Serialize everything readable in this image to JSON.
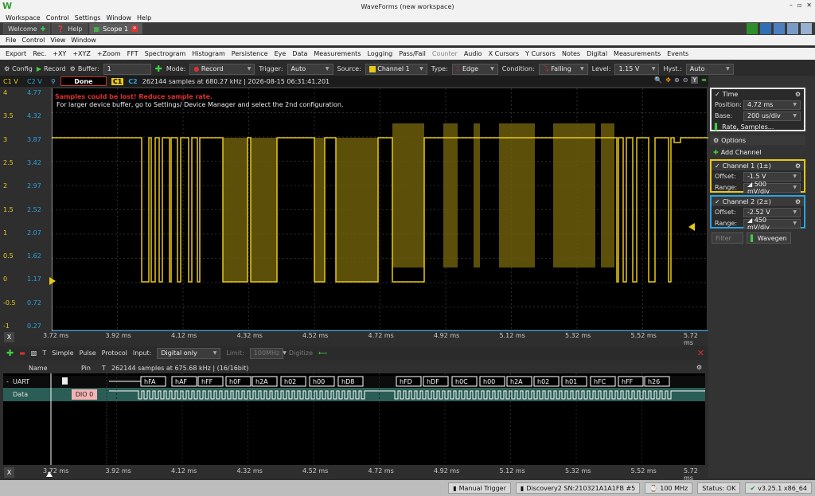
{
  "app": {
    "title": "WaveForms (new workspace)",
    "window_controls": [
      "–",
      "▫",
      "✕"
    ]
  },
  "main_menu": [
    "Workspace",
    "Control",
    "Settings",
    "Window",
    "Help"
  ],
  "tabs": [
    {
      "label": "Welcome"
    },
    {
      "label": "Help"
    },
    {
      "label": "Scope 1"
    }
  ],
  "scope_menu": [
    "File",
    "Control",
    "View",
    "Window"
  ],
  "scope_toolbar": [
    "Export",
    "Rec.",
    "+XY",
    "+XYZ",
    "+Zoom",
    "FFT",
    "Spectrogram",
    "Histogram",
    "Persistence",
    "Eye",
    "Data",
    "Measurements",
    "Logging",
    "Pass/Fail",
    "Counter",
    "Audio",
    "X Cursors",
    "Y Cursors",
    "Notes",
    "Digital",
    "Measurements",
    "Events"
  ],
  "acquisition": {
    "config_label": "Config",
    "record_label": "Record",
    "buffer_label": "Buffer:",
    "buffer_value": "1",
    "mode_label": "Mode:",
    "mode_value": "Record",
    "trigger_label": "Trigger:",
    "trigger_value": "Auto",
    "source_label": "Source:",
    "source_value": "Channel 1",
    "type_label": "Type:",
    "type_value": "Edge",
    "condition_label": "Condition:",
    "condition_value": "Falling",
    "level_label": "Level:",
    "level_value": "1.15 V",
    "hyst_label": "Hyst.:",
    "hyst_value": "Auto"
  },
  "plot_status": {
    "c1": "C1 V",
    "c2": "C2 V",
    "state": "Done",
    "c1_tag": "C1",
    "c2_tag": "C2",
    "info": "262144 samples at 680.27 kHz | 2026-08-15 06:31:41.201",
    "warning": "Samples could be lost! Reduce sample rate.",
    "note": "For larger device buffer, go to Settings/ Device Manager and select the 2nd configuration."
  },
  "y_axis_c1": [
    "4",
    "3.5",
    "3",
    "2.5",
    "2",
    "1.5",
    "1",
    "0.5",
    "0",
    "-0.5",
    "-1"
  ],
  "y_axis_c2": [
    "4.77",
    "4.32",
    "3.87",
    "3.42",
    "2.97",
    "2.52",
    "2.07",
    "1.62",
    "1.17",
    "0.72",
    "0.27"
  ],
  "x_axis": [
    "3.72 ms",
    "3.92 ms",
    "4.12 ms",
    "4.32 ms",
    "4.52 ms",
    "4.72 ms",
    "4.92 ms",
    "5.12 ms",
    "5.32 ms",
    "5.52 ms",
    "5.72 ms"
  ],
  "right_panel": {
    "time_title": "Time",
    "position_label": "Position:",
    "position_value": "4.72 ms",
    "base_label": "Base:",
    "base_value": "200 us/div",
    "rate_label": "Rate, Samples...",
    "options_label": "Options",
    "add_channel_label": "Add Channel",
    "ch1_title": "Channel 1 (1±)",
    "ch1_offset_label": "Offset:",
    "ch1_offset_value": "-1.5 V",
    "ch1_range_label": "Range:",
    "ch1_range_value": "500 mV/div",
    "ch2_title": "Channel 2 (2±)",
    "ch2_offset_label": "Offset:",
    "ch2_offset_value": "-2.52 V",
    "ch2_range_label": "Range:",
    "ch2_range_value": "450 mV/div",
    "filter_label": "Filter",
    "wavegen_label": "Wavegen"
  },
  "logic_toolbar": {
    "simple": "Simple",
    "pulse": "Pulse",
    "protocol": "Protocol",
    "input_label": "Input:",
    "input_value": "Digital only",
    "limit_label": "Limit:",
    "limit_value": "100MHz",
    "digitize": "Digitize"
  },
  "logic_header": {
    "name": "Name",
    "pin": "Pin",
    "t": "T",
    "info": "262144 samples at 675.68 kHz | (16/16bit)"
  },
  "logic_rows": {
    "uart_name": "UART",
    "data_name": "Data",
    "data_pin": "DIO 0",
    "uart_bytes": [
      "hFA",
      "hAF",
      "hFF",
      "h0F",
      "h2A",
      "h02",
      "h00",
      "hD8",
      "hFD",
      "hDF",
      "h0C",
      "h00",
      "h2A",
      "h02",
      "h01",
      "hFC",
      "hFF",
      "h26"
    ]
  },
  "status_bar": {
    "manual_trigger": "Manual Trigger",
    "device": "Discovery2 SN:210321A1A1FB #5",
    "clock": "100 MHz",
    "status": "Status: OK",
    "version": "v3.25.1 x86_64"
  },
  "colors": {
    "c1": "#e8c81a",
    "c2": "#2aa3e0",
    "accent_green": "#3fd03f",
    "warning_red": "#e03030",
    "logic_teal": "#2a5d55"
  }
}
